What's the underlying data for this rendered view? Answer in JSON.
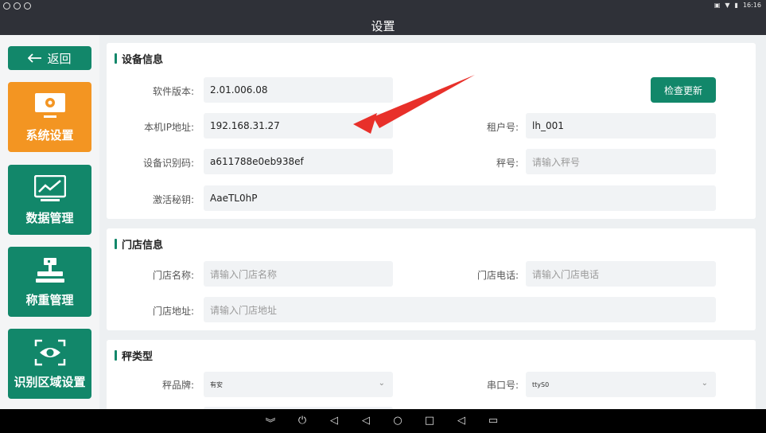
{
  "status_bar": {
    "time": "16:16",
    "icons": [
      "screenshot-icon",
      "wifi-icon",
      "battery-icon"
    ]
  },
  "title": "设置",
  "sidebar": {
    "back_label": "返回",
    "items": [
      {
        "label": "系统设置",
        "icon": "system-settings-icon",
        "active": true
      },
      {
        "label": "数据管理",
        "icon": "chart-icon",
        "active": false
      },
      {
        "label": "称重管理",
        "icon": "scale-icon",
        "active": false
      },
      {
        "label": "识别区域设置",
        "icon": "eye-scan-icon",
        "active": false
      }
    ]
  },
  "device_info": {
    "title": "设备信息",
    "check_update_label": "检查更新",
    "software_version": {
      "label": "软件版本:",
      "value": "2.01.006.08"
    },
    "ip_address": {
      "label": "本机IP地址:",
      "value": "192.168.31.27"
    },
    "tenant_id": {
      "label": "租户号:",
      "value": "lh_001"
    },
    "device_id": {
      "label": "设备识别码:",
      "value": "a611788e0eb938ef"
    },
    "scale_no": {
      "label": "秤号:",
      "placeholder": "请输入秤号"
    },
    "activation_key": {
      "label": "激活秘钥:",
      "value": "AaeTL0hP"
    }
  },
  "store_info": {
    "title": "门店信息",
    "store_name": {
      "label": "门店名称:",
      "placeholder": "请输入门店名称"
    },
    "store_phone": {
      "label": "门店电话:",
      "placeholder": "请输入门店电话"
    },
    "store_address": {
      "label": "门店地址:",
      "placeholder": "请输入门店地址"
    }
  },
  "scale_type": {
    "title": "秤类型",
    "brand": {
      "label": "秤品牌:",
      "value": "有安"
    },
    "serial_port": {
      "label": "串口号:",
      "value": "ttyS0"
    }
  },
  "colors": {
    "primary": "#12876a",
    "active": "#f39522",
    "background": "#edf0f2",
    "annotation_arrow": "#e8302a"
  }
}
